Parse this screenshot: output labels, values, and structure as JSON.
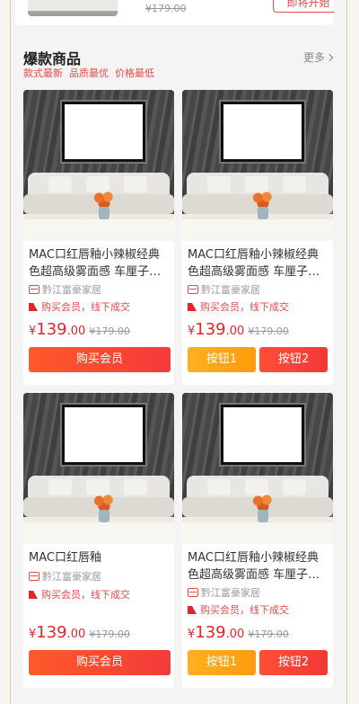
{
  "top": {
    "old_price": "¥179.00",
    "button_label": "即将开始"
  },
  "section": {
    "title": "爆款商品",
    "more_label": "更多",
    "tags": [
      "款式最新",
      "品质最优",
      "价格最低"
    ]
  },
  "products": [
    {
      "title": "MAC口红唇釉小辣椒经典色超高级雾面感 车厘子…",
      "store": "黔江富豪家居",
      "promo": "购买会员，线下成交",
      "price_symbol": "¥",
      "price_int": "139",
      "price_dec": ".00",
      "old_price": "¥179.00",
      "button": "购买会员"
    },
    {
      "title": "MAC口红唇釉小辣椒经典色超高级雾面感 车厘子…",
      "store": "黔江富豪家居",
      "promo": "购买会员，线下成交",
      "price_symbol": "¥",
      "price_int": "139",
      "price_dec": ".00",
      "old_price": "¥179.00",
      "button1": "按钮1",
      "button2": "按钮2"
    },
    {
      "title": "MAC口红唇釉",
      "store": "黔江富豪家居",
      "promo": "购买会员，线下成交",
      "price_symbol": "¥",
      "price_int": "139",
      "price_dec": ".00",
      "old_price": "¥179.00",
      "button": "购买会员"
    },
    {
      "title": "MAC口红唇釉小辣椒经典色超高级雾面感 车厘子…",
      "store": "黔江富豪家居",
      "promo": "购买会员，线下成交",
      "price_symbol": "¥",
      "price_int": "139",
      "price_dec": ".00",
      "old_price": "¥179.00",
      "button1": "按钮1",
      "button2": "按钮2"
    }
  ],
  "colors": {
    "accent_red": "#e5242a",
    "button_orange": "#ff9b0c",
    "border_gold": "#e8c89a"
  }
}
